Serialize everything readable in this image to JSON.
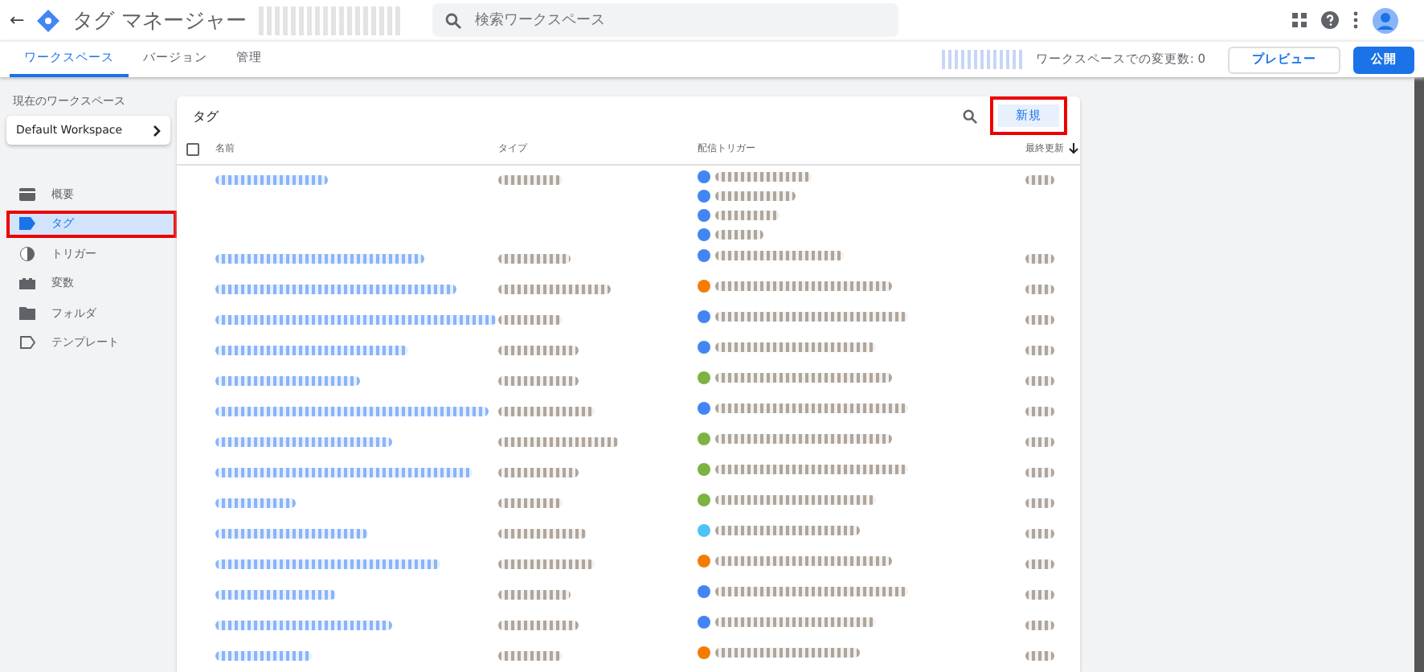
{
  "header": {
    "back": "←",
    "title": "タグ マネージャー",
    "search_placeholder": "検索ワークスペース"
  },
  "tabs": [
    {
      "label": "ワークスペース",
      "selected": true
    },
    {
      "label": "バージョン",
      "selected": false
    },
    {
      "label": "管理",
      "selected": false
    }
  ],
  "toolbar": {
    "changes": "ワークスペースでの変更数: 0",
    "preview": "プレビュー",
    "publish": "公開"
  },
  "sidebar": {
    "workspace_label": "現在のワークスペース",
    "workspace": "Default Workspace",
    "items": [
      {
        "kind": "overview",
        "label": "概要",
        "selected": false,
        "highlighted": false
      },
      {
        "kind": "tag",
        "label": "タグ",
        "selected": true,
        "highlighted": true
      },
      {
        "kind": "trigger",
        "label": "トリガー",
        "selected": false,
        "highlighted": false
      },
      {
        "kind": "variable",
        "label": "変数",
        "selected": false,
        "highlighted": false
      },
      {
        "kind": "folder",
        "label": "フォルダ",
        "selected": false,
        "highlighted": false
      },
      {
        "kind": "template",
        "label": "テンプレート",
        "selected": false,
        "highlighted": false
      }
    ]
  },
  "table": {
    "title": "タグ",
    "new_button": {
      "label": "新規",
      "highlighted": true
    },
    "select_all": {
      "checked": false
    },
    "columns": [
      "名前",
      "タイプ",
      "配信トリガー",
      "最終更新"
    ],
    "redacted_rows": [
      {
        "triggers": [
          {
            "color": "#4285f4"
          },
          {
            "color": "#4285f4"
          },
          {
            "color": "#4285f4"
          },
          {
            "color": "#4285f4"
          }
        ]
      },
      {
        "triggers": [
          {
            "color": "#4285f4"
          }
        ]
      },
      {
        "triggers": [
          {
            "color": "#f57c00"
          }
        ]
      },
      {
        "triggers": [
          {
            "color": "#4285f4"
          }
        ]
      },
      {
        "triggers": [
          {
            "color": "#4285f4"
          }
        ]
      },
      {
        "triggers": [
          {
            "color": "#7cb342"
          }
        ]
      },
      {
        "triggers": [
          {
            "color": "#4285f4"
          }
        ]
      },
      {
        "triggers": [
          {
            "color": "#7cb342"
          }
        ]
      },
      {
        "triggers": [
          {
            "color": "#7cb342"
          }
        ]
      },
      {
        "triggers": [
          {
            "color": "#7cb342"
          }
        ]
      },
      {
        "triggers": [
          {
            "color": "#4fc3f7"
          }
        ]
      },
      {
        "triggers": [
          {
            "color": "#f57c00"
          }
        ]
      },
      {
        "triggers": [
          {
            "color": "#4285f4"
          }
        ]
      },
      {
        "triggers": [
          {
            "color": "#4285f4"
          }
        ]
      },
      {
        "triggers": [
          {
            "color": "#f57c00"
          }
        ]
      }
    ]
  }
}
